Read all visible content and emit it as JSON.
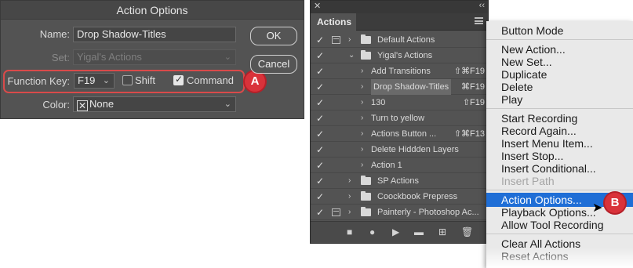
{
  "dialog": {
    "title": "Action Options",
    "name_label": "Name:",
    "name_value": "Drop Shadow-Titles",
    "set_label": "Set:",
    "set_value": "Yigal's Actions",
    "function_key_label": "Function Key:",
    "function_key_value": "F19",
    "shift_label": "Shift",
    "shift_checked": false,
    "command_label": "Command",
    "command_checked": true,
    "color_label": "Color:",
    "color_value": "None",
    "ok_label": "OK",
    "cancel_label": "Cancel",
    "callout": "A"
  },
  "panel": {
    "close_glyph": "✕",
    "collapse_glyph": "‹‹",
    "tab_label": "Actions",
    "items": [
      {
        "level": 0,
        "folder": true,
        "expanded": false,
        "dialog": true,
        "label": "Default Actions",
        "key": ""
      },
      {
        "level": 0,
        "folder": true,
        "expanded": true,
        "dialog": false,
        "label": "Yigal's Actions",
        "key": ""
      },
      {
        "level": 1,
        "folder": false,
        "expanded": false,
        "dialog": false,
        "label": "Add Transitions",
        "key": "⇧⌘F19"
      },
      {
        "level": 1,
        "folder": false,
        "expanded": false,
        "dialog": false,
        "label": "Drop Shadow-Titles",
        "key": "⌘F19",
        "highlight": true
      },
      {
        "level": 1,
        "folder": false,
        "expanded": false,
        "dialog": false,
        "label": "130",
        "key": "⇧F19"
      },
      {
        "level": 1,
        "folder": false,
        "expanded": false,
        "dialog": false,
        "label": "Turn to yellow",
        "key": ""
      },
      {
        "level": 1,
        "folder": false,
        "expanded": false,
        "dialog": false,
        "label": "Actions Button ...",
        "key": "⇧⌘F13"
      },
      {
        "level": 1,
        "folder": false,
        "expanded": false,
        "dialog": false,
        "label": "Delete Hiddden Layers",
        "key": ""
      },
      {
        "level": 1,
        "folder": false,
        "expanded": false,
        "dialog": false,
        "label": "Action 1",
        "key": ""
      },
      {
        "level": 0,
        "folder": true,
        "expanded": false,
        "dialog": false,
        "label": "SP Actions",
        "key": ""
      },
      {
        "level": 0,
        "folder": true,
        "expanded": false,
        "dialog": false,
        "label": "Coockbook Prepress",
        "key": ""
      },
      {
        "level": 0,
        "folder": true,
        "expanded": false,
        "dialog": true,
        "label": "Painterly - Photoshop Ac...",
        "key": ""
      }
    ],
    "bottom_icons": [
      "stop-icon",
      "record-icon",
      "play-icon",
      "new-set-icon",
      "new-action-icon",
      "delete-icon"
    ]
  },
  "menu": {
    "groups": [
      [
        "Button Mode"
      ],
      [
        "New Action...",
        "New Set...",
        "Duplicate",
        "Delete",
        "Play"
      ],
      [
        "Start Recording",
        "Record Again...",
        "Insert Menu Item...",
        "Insert Stop...",
        "Insert Conditional...",
        "Insert Path"
      ],
      [
        "Action Options...",
        "Playback Options...",
        "Allow Tool Recording"
      ],
      [
        "Clear All Actions",
        "Reset Actions"
      ]
    ],
    "disabled": [
      "Insert Path"
    ],
    "active": "Action Options...",
    "callout": "B"
  },
  "colors": {
    "accent": "#1f6ed6",
    "callout": "#d9323a",
    "outline": "#d94a4a"
  }
}
